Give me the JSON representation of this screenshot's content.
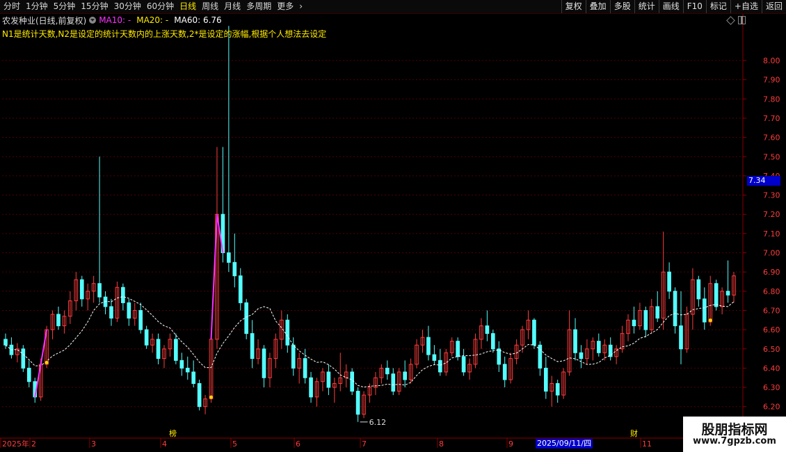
{
  "toolbar": {
    "periods": [
      "分时",
      "1分钟",
      "5分钟",
      "15分钟",
      "30分钟",
      "60分钟",
      "日线",
      "周线",
      "月线",
      "多周期",
      "更多"
    ],
    "active_period": "日线",
    "more_arrow": "›",
    "right_buttons": [
      "复权",
      "叠加",
      "多股",
      "统计",
      "画线",
      "F10",
      "标记",
      "+自选",
      "返回"
    ]
  },
  "header": {
    "stock": "农发种业(日线,前复权)",
    "ma10": "MA10: -",
    "ma20": "MA20: -",
    "ma60": "MA60: 6.76",
    "description": "N1是统计天数,N2是设定的统计天数内的上涨天数,2*是设定的涨幅,根据个人想法去设定"
  },
  "price_axis": {
    "labels": [
      "8.00",
      "7.90",
      "7.80",
      "7.70",
      "7.60",
      "7.50",
      "7.40",
      "7.30",
      "7.20",
      "7.10",
      "7.00",
      "6.90",
      "6.80",
      "6.70",
      "6.60",
      "6.50",
      "6.40",
      "6.30",
      "6.20"
    ],
    "current": "7.34"
  },
  "annotations": {
    "low_label": "6.12",
    "bang": "榜",
    "cai": "财"
  },
  "time_axis": {
    "labels": [
      "2025年",
      "2",
      "3",
      "4",
      "5",
      "6",
      "7",
      "8",
      "9",
      "10",
      "11"
    ],
    "cursor_date": "2025/09/11/四"
  },
  "watermark": {
    "line1": "股朋指标网",
    "line2": "www.7gpzb.com"
  },
  "colors": {
    "up": "#ff3c3c",
    "down": "#54ffff",
    "ma": "#ffffff",
    "signal": "#ff30ff",
    "dot": "#ffd400",
    "grid": "#550000",
    "axis_text": "#ff3c3c"
  },
  "chart_data": {
    "type": "candlestick",
    "ylim": [
      6.12,
      8.05
    ],
    "candles": [
      [
        6.55,
        6.58,
        6.5,
        6.52
      ],
      [
        6.52,
        6.56,
        6.45,
        6.47
      ],
      [
        6.47,
        6.53,
        6.43,
        6.5
      ],
      [
        6.5,
        6.52,
        6.38,
        6.4
      ],
      [
        6.4,
        6.44,
        6.3,
        6.33
      ],
      [
        6.33,
        6.35,
        6.22,
        6.25
      ],
      [
        6.25,
        6.45,
        6.23,
        6.42
      ],
      [
        6.42,
        6.62,
        6.4,
        6.6
      ],
      [
        6.6,
        6.7,
        6.55,
        6.68
      ],
      [
        6.68,
        6.72,
        6.6,
        6.62
      ],
      [
        6.62,
        6.7,
        6.58,
        6.67
      ],
      [
        6.67,
        6.8,
        6.63,
        6.75
      ],
      [
        6.75,
        6.9,
        6.7,
        6.86
      ],
      [
        6.86,
        6.88,
        6.72,
        6.76
      ],
      [
        6.76,
        6.84,
        6.7,
        6.8
      ],
      [
        6.8,
        6.88,
        6.74,
        6.84
      ],
      [
        6.84,
        7.5,
        6.74,
        6.77
      ],
      [
        6.77,
        6.8,
        6.68,
        6.72
      ],
      [
        6.72,
        6.76,
        6.62,
        6.66
      ],
      [
        6.66,
        6.85,
        6.64,
        6.82
      ],
      [
        6.82,
        6.84,
        6.7,
        6.74
      ],
      [
        6.74,
        6.76,
        6.62,
        6.66
      ],
      [
        6.66,
        6.74,
        6.62,
        6.7
      ],
      [
        6.7,
        6.74,
        6.58,
        6.6
      ],
      [
        6.6,
        6.62,
        6.5,
        6.52
      ],
      [
        6.52,
        6.58,
        6.48,
        6.55
      ],
      [
        6.55,
        6.58,
        6.42,
        6.45
      ],
      [
        6.45,
        6.52,
        6.4,
        6.5
      ],
      [
        6.5,
        6.58,
        6.46,
        6.55
      ],
      [
        6.55,
        6.58,
        6.42,
        6.44
      ],
      [
        6.44,
        6.48,
        6.36,
        6.4
      ],
      [
        6.4,
        6.46,
        6.34,
        6.38
      ],
      [
        6.38,
        6.44,
        6.3,
        6.32
      ],
      [
        6.32,
        6.34,
        6.18,
        6.2
      ],
      [
        6.2,
        6.26,
        6.16,
        6.24
      ],
      [
        6.24,
        6.58,
        6.22,
        6.55
      ],
      [
        6.55,
        7.55,
        6.5,
        7.2
      ],
      [
        7.2,
        7.55,
        6.95,
        7.0
      ],
      [
        7.0,
        8.18,
        6.9,
        6.95
      ],
      [
        6.95,
        7.1,
        6.82,
        6.88
      ],
      [
        6.88,
        6.92,
        6.7,
        6.74
      ],
      [
        6.74,
        6.76,
        6.55,
        6.58
      ],
      [
        6.58,
        6.65,
        6.4,
        6.45
      ],
      [
        6.45,
        6.55,
        6.42,
        6.5
      ],
      [
        6.5,
        6.52,
        6.3,
        6.35
      ],
      [
        6.35,
        6.48,
        6.3,
        6.45
      ],
      [
        6.45,
        6.58,
        6.4,
        6.55
      ],
      [
        6.55,
        6.7,
        6.5,
        6.65
      ],
      [
        6.65,
        6.68,
        6.48,
        6.52
      ],
      [
        6.52,
        6.56,
        6.36,
        6.4
      ],
      [
        6.4,
        6.48,
        6.32,
        6.45
      ],
      [
        6.45,
        6.5,
        6.32,
        6.35
      ],
      [
        6.35,
        6.38,
        6.22,
        6.25
      ],
      [
        6.25,
        6.35,
        6.2,
        6.33
      ],
      [
        6.33,
        6.4,
        6.28,
        6.38
      ],
      [
        6.38,
        6.42,
        6.26,
        6.3
      ],
      [
        6.3,
        6.35,
        6.22,
        6.32
      ],
      [
        6.32,
        6.48,
        6.28,
        6.35
      ],
      [
        6.35,
        6.42,
        6.3,
        6.38
      ],
      [
        6.38,
        6.4,
        6.26,
        6.28
      ],
      [
        6.28,
        6.3,
        6.12,
        6.16
      ],
      [
        6.16,
        6.28,
        6.14,
        6.26
      ],
      [
        6.26,
        6.32,
        6.22,
        6.3
      ],
      [
        6.3,
        6.38,
        6.26,
        6.35
      ],
      [
        6.35,
        6.42,
        6.32,
        6.4
      ],
      [
        6.4,
        6.44,
        6.34,
        6.37
      ],
      [
        6.37,
        6.4,
        6.26,
        6.28
      ],
      [
        6.28,
        6.4,
        6.26,
        6.38
      ],
      [
        6.38,
        6.44,
        6.3,
        6.34
      ],
      [
        6.34,
        6.45,
        6.32,
        6.42
      ],
      [
        6.42,
        6.55,
        6.4,
        6.52
      ],
      [
        6.52,
        6.6,
        6.48,
        6.56
      ],
      [
        6.56,
        6.62,
        6.44,
        6.47
      ],
      [
        6.47,
        6.52,
        6.42,
        6.44
      ],
      [
        6.44,
        6.5,
        6.36,
        6.38
      ],
      [
        6.38,
        6.5,
        6.36,
        6.48
      ],
      [
        6.48,
        6.56,
        6.46,
        6.54
      ],
      [
        6.54,
        6.56,
        6.44,
        6.46
      ],
      [
        6.46,
        6.5,
        6.36,
        6.38
      ],
      [
        6.38,
        6.45,
        6.34,
        6.42
      ],
      [
        6.42,
        6.58,
        6.4,
        6.55
      ],
      [
        6.55,
        6.66,
        6.5,
        6.62
      ],
      [
        6.62,
        6.7,
        6.54,
        6.58
      ],
      [
        6.58,
        6.6,
        6.48,
        6.5
      ],
      [
        6.5,
        6.54,
        6.38,
        6.42
      ],
      [
        6.42,
        6.46,
        6.3,
        6.34
      ],
      [
        6.34,
        6.48,
        6.32,
        6.45
      ],
      [
        6.45,
        6.55,
        6.42,
        6.52
      ],
      [
        6.52,
        6.62,
        6.48,
        6.6
      ],
      [
        6.6,
        6.7,
        6.55,
        6.65
      ],
      [
        6.65,
        6.66,
        6.5,
        6.52
      ],
      [
        6.52,
        6.54,
        6.36,
        6.4
      ],
      [
        6.4,
        6.46,
        6.24,
        6.28
      ],
      [
        6.28,
        6.36,
        6.2,
        6.32
      ],
      [
        6.32,
        6.34,
        6.22,
        6.26
      ],
      [
        6.26,
        6.4,
        6.24,
        6.38
      ],
      [
        6.38,
        6.7,
        6.36,
        6.6
      ],
      [
        6.6,
        6.66,
        6.44,
        6.48
      ],
      [
        6.48,
        6.52,
        6.4,
        6.45
      ],
      [
        6.45,
        6.55,
        6.42,
        6.5
      ],
      [
        6.5,
        6.56,
        6.44,
        6.54
      ],
      [
        6.54,
        6.58,
        6.46,
        6.48
      ],
      [
        6.48,
        6.55,
        6.44,
        6.52
      ],
      [
        6.52,
        6.56,
        6.44,
        6.46
      ],
      [
        6.46,
        6.52,
        6.42,
        6.5
      ],
      [
        6.5,
        6.62,
        6.48,
        6.58
      ],
      [
        6.58,
        6.68,
        6.54,
        6.65
      ],
      [
        6.65,
        6.72,
        6.58,
        6.62
      ],
      [
        6.62,
        6.74,
        6.6,
        6.7
      ],
      [
        6.7,
        6.72,
        6.56,
        6.6
      ],
      [
        6.6,
        6.76,
        6.58,
        6.72
      ],
      [
        6.72,
        6.8,
        6.64,
        6.66
      ],
      [
        6.66,
        7.11,
        6.6,
        6.9
      ],
      [
        6.9,
        6.95,
        6.76,
        6.8
      ],
      [
        6.8,
        6.82,
        6.58,
        6.62
      ],
      [
        6.62,
        6.8,
        6.42,
        6.5
      ],
      [
        6.5,
        6.72,
        6.48,
        6.68
      ],
      [
        6.68,
        6.92,
        6.6,
        6.86
      ],
      [
        6.86,
        6.88,
        6.72,
        6.76
      ],
      [
        6.76,
        6.82,
        6.6,
        6.64
      ],
      [
        6.64,
        6.88,
        6.62,
        6.84
      ],
      [
        6.84,
        6.86,
        6.7,
        6.72
      ],
      [
        6.72,
        6.82,
        6.68,
        6.8
      ],
      [
        6.8,
        6.96,
        6.74,
        6.78
      ],
      [
        6.78,
        6.9,
        6.74,
        6.88
      ]
    ]
  }
}
